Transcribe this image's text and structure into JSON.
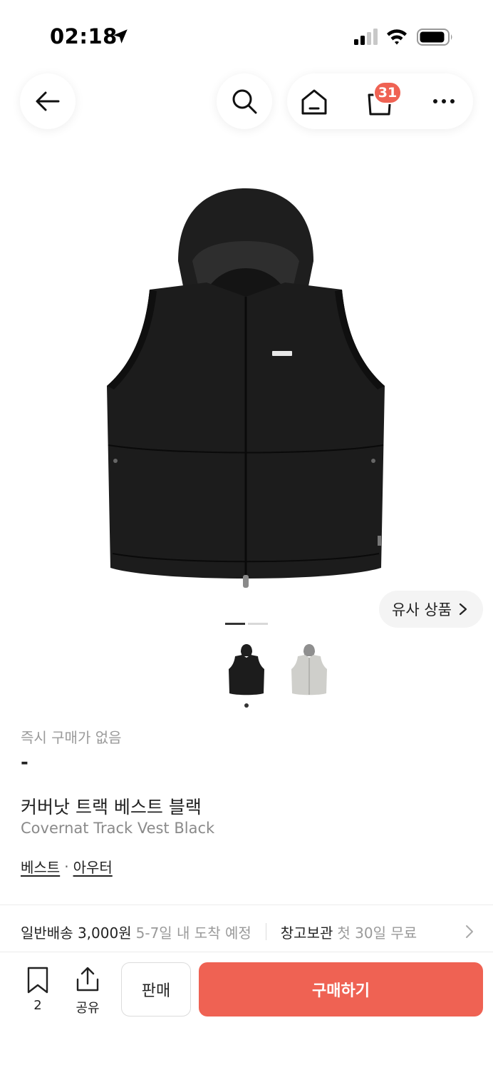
{
  "status_bar": {
    "time": "02:18",
    "icons": [
      "location-arrow-icon",
      "cellular-signal-icon",
      "wifi-icon",
      "battery-icon"
    ]
  },
  "nav": {
    "icons": [
      "back-arrow-icon",
      "search-icon",
      "home-icon",
      "shopping-bag-icon",
      "more-icon"
    ],
    "cart_badge": "31"
  },
  "product": {
    "similar_label": "유사 상품",
    "slide_count": 2,
    "active_slide": 1,
    "thumbnails": [
      "black-vest-thumbnail",
      "gray-vest-thumbnail"
    ],
    "instant_label": "즉시 구매가 없음",
    "price": "-",
    "title_ko": "커버낫 트랙 베스트 블랙",
    "title_en": "Covernat Track Vest Black",
    "categories": [
      "베스트",
      "아우터"
    ],
    "category_separator": "·"
  },
  "delivery": {
    "main": "일반배송 3,000원",
    "sub": "5-7일 내 도착 예정",
    "storage_main": "창고보관",
    "storage_sub": "첫 30일 무료"
  },
  "actions": {
    "bookmark_count": "2",
    "share_label": "공유",
    "sell_label": "판매",
    "buy_label": "구매하기"
  },
  "colors": {
    "accent": "#ef6253",
    "text": "#222222",
    "muted": "#9a9a9a"
  }
}
